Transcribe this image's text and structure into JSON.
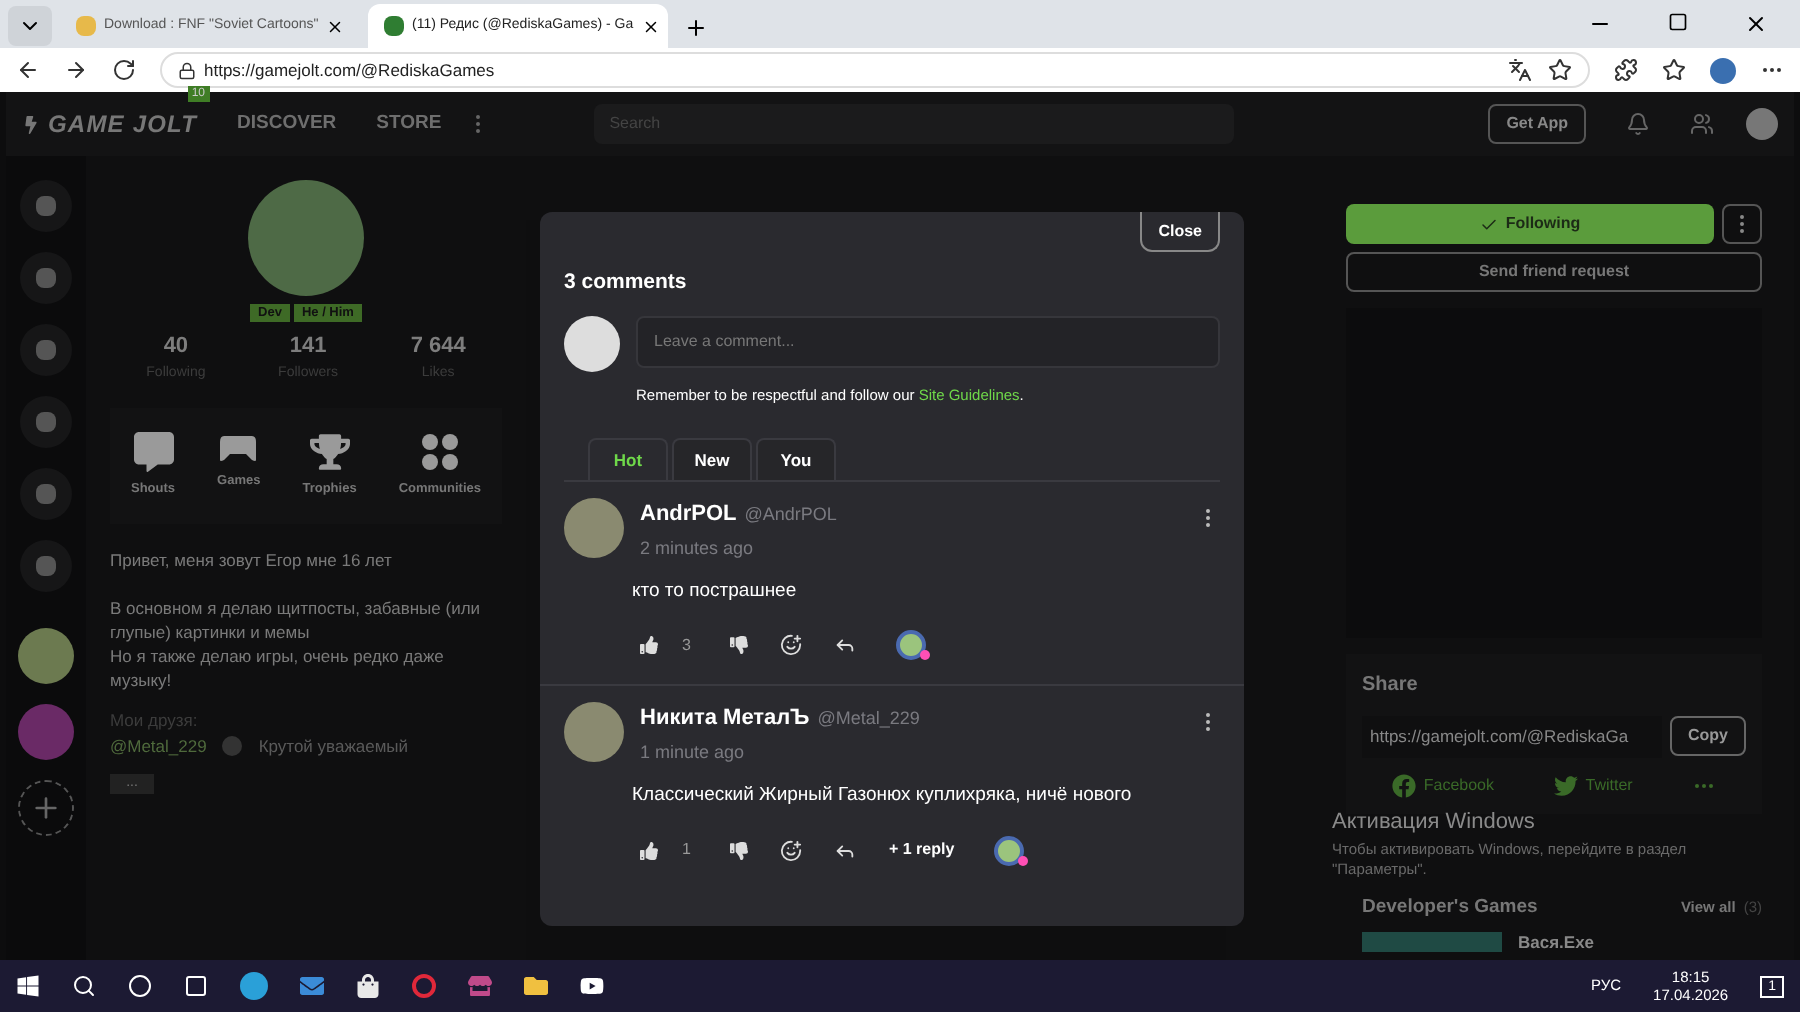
{
  "browser": {
    "tabs": [
      {
        "title": "Download : FNF \"Soviet Cartoons\"",
        "selected": false
      },
      {
        "title": "(11) Редис (@RediskaGames) - Ga",
        "selected": true
      }
    ],
    "url": "https://gamejolt.com/@RediskaGames"
  },
  "header": {
    "logo": "GAME JOLT",
    "badge": "10",
    "nav": [
      "DISCOVER",
      "STORE"
    ],
    "search_placeholder": "Search",
    "get_app": "Get App"
  },
  "profile": {
    "tags": [
      "Dev",
      "He / Him"
    ],
    "stats": [
      {
        "value": "40",
        "label": "Following"
      },
      {
        "value": "141",
        "label": "Followers"
      },
      {
        "value": "7 644",
        "label": "Likes"
      }
    ],
    "sections": [
      {
        "label": "Shouts",
        "kind": "shouts"
      },
      {
        "label": "Games",
        "kind": "games"
      },
      {
        "label": "Trophies",
        "kind": "trophies"
      },
      {
        "label": "Communities",
        "kind": "communities"
      }
    ],
    "bio": [
      "Привет, меня зовут Егор мне 16 лет",
      "В основном я делаю щитпосты, забавные (или глупые) картинки и мемы",
      "Но я также делаю игры, очень редко даже музыку!"
    ],
    "friends_label": "Мои друзя:",
    "friend_handle": "@Metal_229",
    "friend_note": "Крутой уважаемый",
    "more": "..."
  },
  "modal": {
    "close": "Close",
    "title": "3 comments",
    "placeholder": "Leave a comment...",
    "notice": "Remember to be respectful and follow our",
    "notice_link": "Site Guidelines",
    "notice_end": ".",
    "sort_tabs": [
      {
        "label": "Hot",
        "selected": true
      },
      {
        "label": "New",
        "selected": false
      },
      {
        "label": "You",
        "selected": false
      }
    ],
    "comments": [
      {
        "name": "AndrPOL",
        "handle": "@AndrPOL",
        "time": "2 minutes ago",
        "text": "кто то пострашнее",
        "likes": "3"
      },
      {
        "name": "Никита МеталЪ",
        "handle": "@Metal_229",
        "time": "1 minute ago",
        "text": "Классический Жирный Газонюх куплихряка, ничё нового",
        "likes": "1",
        "replies": "+ 1 reply"
      }
    ]
  },
  "right": {
    "following": "Following",
    "friend_request": "Send friend request",
    "share_title": "Share",
    "share_url": "https://gamejolt.com/@RediskaGa",
    "copy": "Copy",
    "socials": [
      {
        "label": "Facebook",
        "kind": "facebook"
      },
      {
        "label": "Twitter",
        "kind": "twitter"
      }
    ],
    "games_title": "Developer's Games",
    "view_all": "View all",
    "view_count": "(3)",
    "game": "Вася.Exe"
  },
  "activation": {
    "title": "Активация Windows",
    "text": "Чтобы активировать Windows, перейдите в раздел \"Параметры\"."
  },
  "taskbar": {
    "lang": "РУС",
    "time": "18:15",
    "date": "17.04.2026",
    "notifications": "1"
  }
}
